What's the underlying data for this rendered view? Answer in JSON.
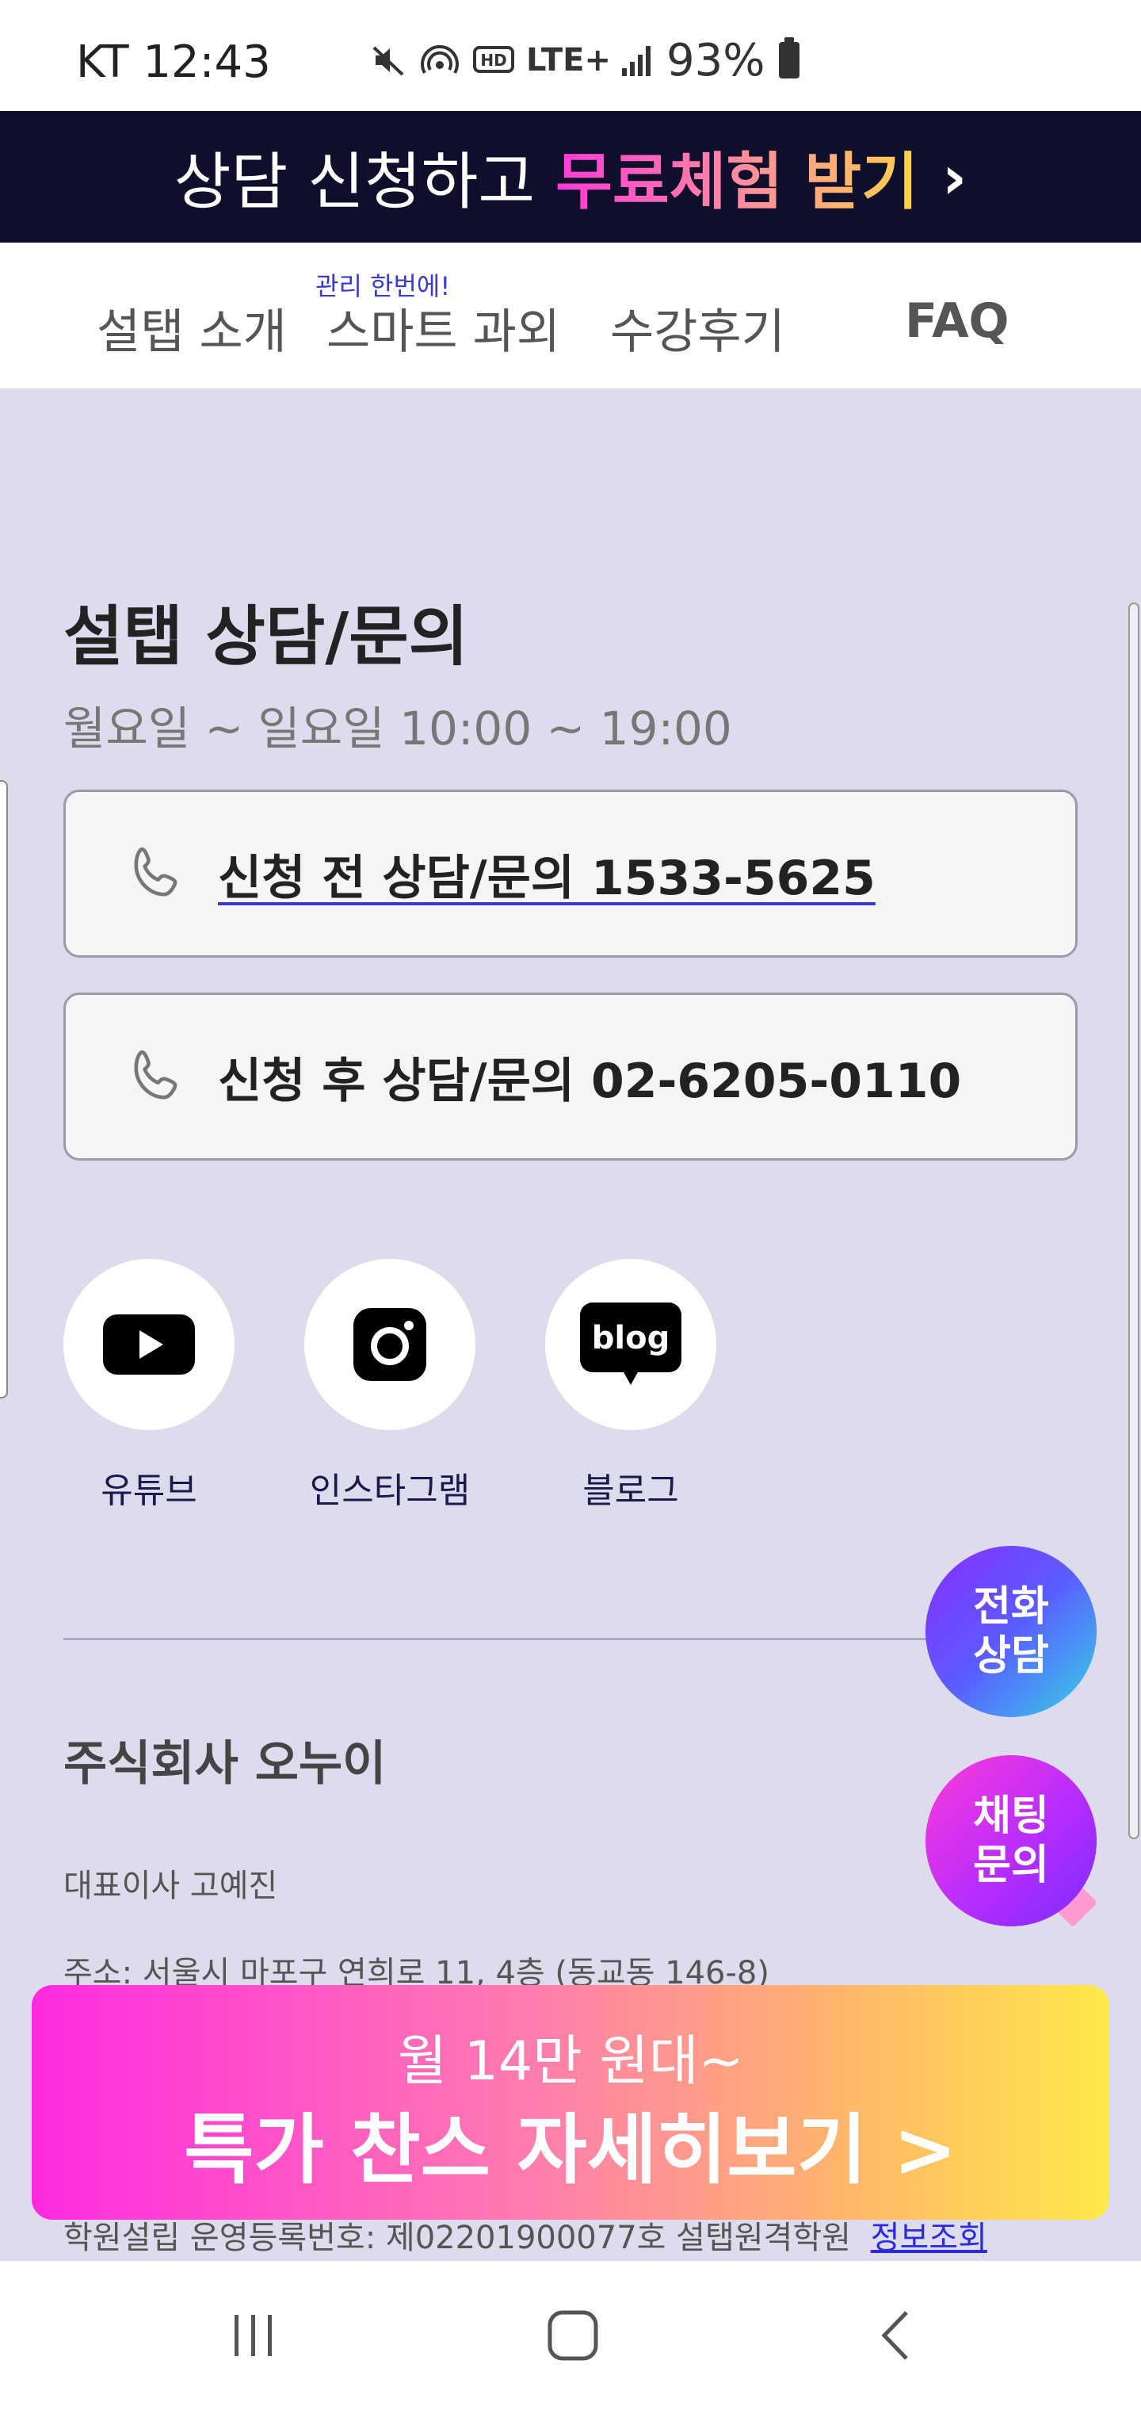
{
  "status_bar": {
    "carrier_time": "KT 12:43",
    "network": "LTE+",
    "battery": "93%"
  },
  "top_banner": {
    "prefix": "상담 신청하고",
    "highlight": "무료체험 받기",
    "chevron": "›"
  },
  "nav": {
    "items": [
      "설탭 소개",
      "스마트 과외",
      "수강후기",
      "FAQ"
    ],
    "smart_badge": "관리 한번에!"
  },
  "consult": {
    "title": "설탭 상담/문의",
    "hours": "월요일 ~ 일요일 10:00 ~ 19:00",
    "phone_before": "신청 전 상담/문의 1533-5625",
    "phone_after": "신청 후 상담/문의 02-6205-0110"
  },
  "social": [
    {
      "label": "유튜브",
      "icon": "youtube-icon"
    },
    {
      "label": "인스타그램",
      "icon": "instagram-icon"
    },
    {
      "label": "블로그",
      "icon": "blog-icon"
    }
  ],
  "company": {
    "name": "주식회사 오누이",
    "ceo": "대표이사 고예진",
    "address": "주소: 서울시 마포구 연희로 11, 4층 (동교동 146-8)",
    "registration": "학원설립 운영등록번호: 제02201900077호 설탭원격학원",
    "registration_link": "정보조회"
  },
  "fab": {
    "call_line1": "전화",
    "call_line2": "상담",
    "chat_line1": "채팅",
    "chat_line2": "문의"
  },
  "promo": {
    "line1": "월 14만 원대~",
    "line2": "특가 찬스 자세히보기 >"
  },
  "colors": {
    "banner_bg": "#0f0f2b",
    "page_bg": "#dcdcec",
    "link": "#2c2cdc",
    "promo_gradient_start": "#ff2ae0",
    "promo_gradient_end": "#ffe94a"
  }
}
